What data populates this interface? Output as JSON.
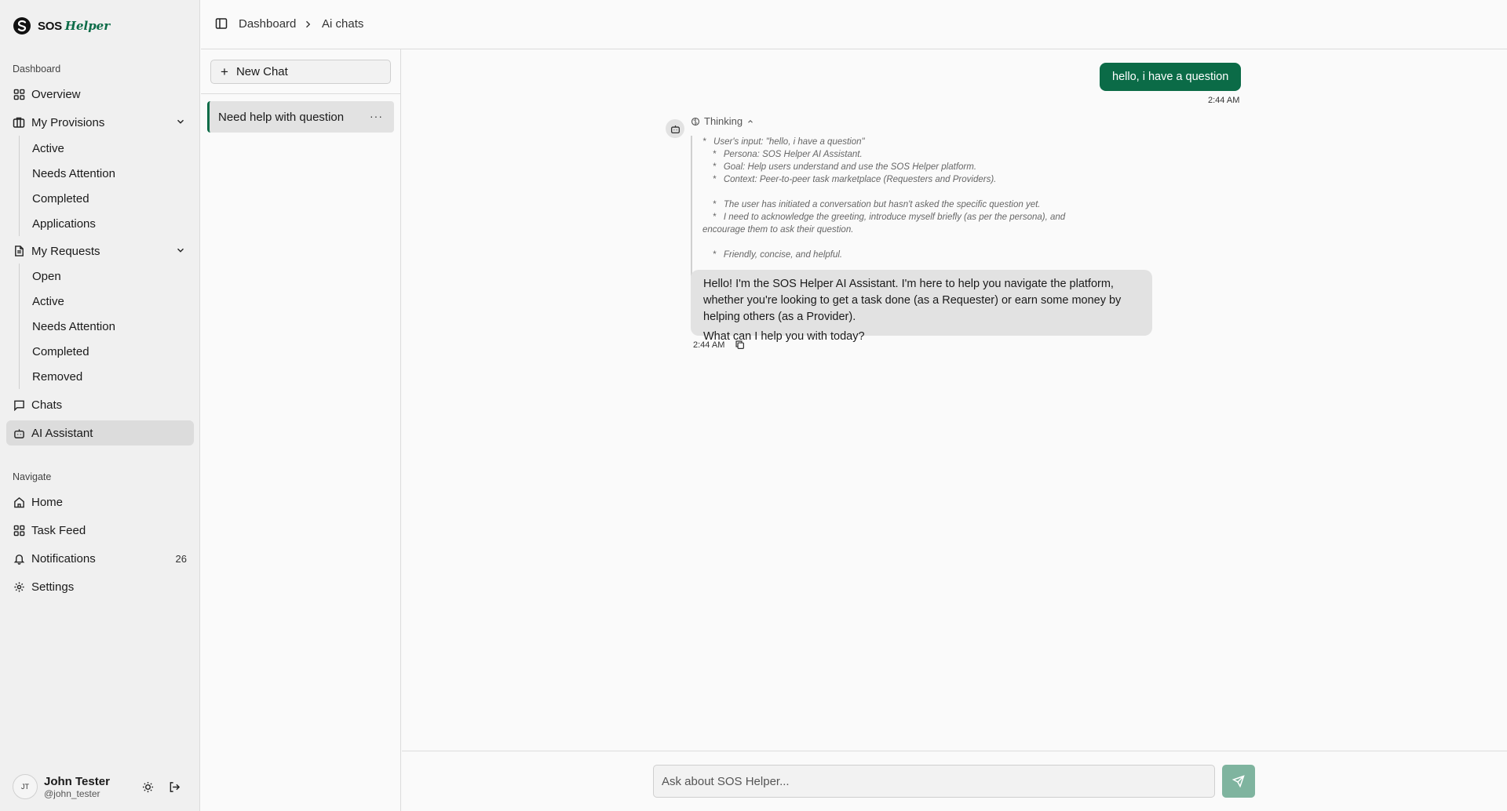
{
  "brand": {
    "name": "SOS",
    "name_accent": "Helper"
  },
  "sidebar": {
    "dashboard_label": "Dashboard",
    "overview": "Overview",
    "my_provisions": {
      "label": "My Provisions",
      "items": [
        "Active",
        "Needs Attention",
        "Completed",
        "Applications"
      ]
    },
    "my_requests": {
      "label": "My Requests",
      "items": [
        "Open",
        "Active",
        "Needs Attention",
        "Completed",
        "Removed"
      ]
    },
    "chats": "Chats",
    "ai_assistant": "AI Assistant",
    "navigate_label": "Navigate",
    "home": "Home",
    "task_feed": "Task Feed",
    "notifications": {
      "label": "Notifications",
      "count": "26"
    },
    "settings": "Settings"
  },
  "user": {
    "initials": "JT",
    "name": "John Tester",
    "handle": "@john_tester"
  },
  "breadcrumb": {
    "root": "Dashboard",
    "current": "Ai chats"
  },
  "chat_list": {
    "new_chat_label": "New Chat",
    "items": [
      {
        "title": "Need help with question"
      }
    ]
  },
  "conversation": {
    "user_message": {
      "text": "hello, i have a question",
      "time": "2:44 AM"
    },
    "thinking": {
      "label": "Thinking",
      "lines": [
        "*   User's input: \"hello, i have a question\"",
        "    *   Persona: SOS Helper AI Assistant.",
        "    *   Goal: Help users understand and use the SOS Helper platform.",
        "    *   Context: Peer-to-peer task marketplace (Requesters and Providers).",
        "",
        "    *   The user has initiated a conversation but hasn't asked the specific question yet.",
        "    *   I need to acknowledge the greeting, introduce myself briefly (as per the persona), and",
        "encourage them to ask their question.",
        "",
        "    *   Friendly, concise, and helpful."
      ]
    },
    "assistant_message": {
      "lines": [
        "Hello! I'm the SOS Helper AI Assistant. I'm here to help you navigate the platform,",
        "whether you're looking to get a task done (as a Requester) or earn some money by",
        "helping others (as a Provider)."
      ],
      "question": "What can I help you with today?",
      "time": "2:44 AM"
    }
  },
  "composer": {
    "placeholder": "Ask about SOS Helper..."
  },
  "colors": {
    "brand_green": "#0b6b47",
    "send_disabled": "#7fb49f",
    "sidebar_bg": "#f0f0f0"
  }
}
